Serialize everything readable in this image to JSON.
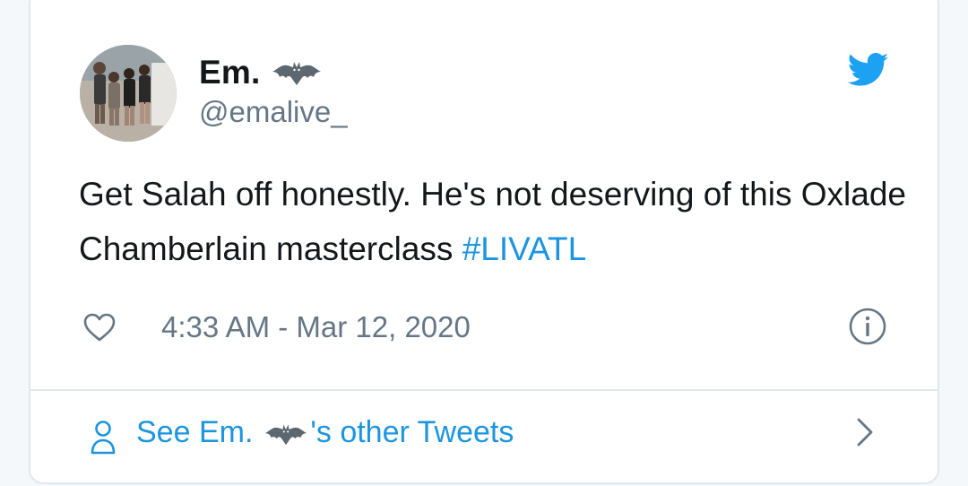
{
  "tweet": {
    "display_name": "Em.",
    "name_emoji_icon": "bat-emoji-icon",
    "handle": "@emalive_",
    "text_main": "Get Salah off honestly. He's not deserving of this Oxlade Chamberlain masterclass ",
    "hashtag": "#LIVATL",
    "timestamp": "4:33 AM - Mar 12, 2020"
  },
  "footer": {
    "prefix": "See Em.",
    "suffix": "'s other Tweets"
  },
  "icons": {
    "brand": "twitter-bird-icon",
    "like": "heart-icon",
    "info": "info-icon",
    "profile": "person-icon",
    "chevron": "chevron-right-icon"
  },
  "colors": {
    "text": "#14171a",
    "secondary": "#657786",
    "link": "#1b95e0",
    "border": "#e1e8ed"
  }
}
